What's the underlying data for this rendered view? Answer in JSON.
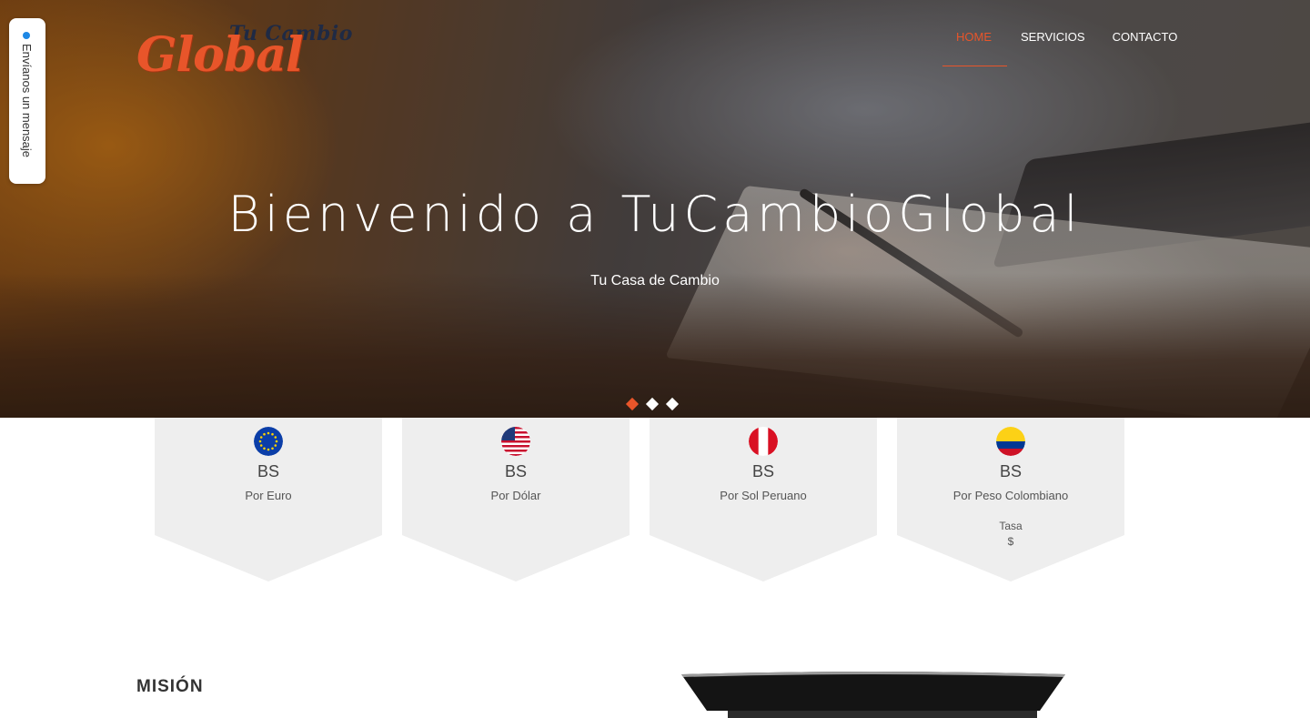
{
  "brand": {
    "logo_top": "Tu Cambio",
    "logo_main": "Global",
    "accent_color": "#e8552a"
  },
  "nav": {
    "items": [
      {
        "label": "HOME",
        "active": true
      },
      {
        "label": "SERVICIOS",
        "active": false
      },
      {
        "label": "CONTACTO",
        "active": false
      }
    ]
  },
  "feedback": {
    "label": "Envíanos un mensaje",
    "icon": "blue-dot-icon"
  },
  "hero": {
    "title": "Bienvenido a TuCambioGlobal",
    "subtitle": "Tu Casa de Cambio",
    "slides": 3,
    "active_slide": 1
  },
  "rates": [
    {
      "flag": "eu-flag-icon",
      "currency": "BS",
      "label": "Por Euro"
    },
    {
      "flag": "us-flag-icon",
      "currency": "BS",
      "label": "Por Dólar"
    },
    {
      "flag": "peru-flag-icon",
      "currency": "BS",
      "label": "Por Sol Peruano"
    },
    {
      "flag": "colombia-flag-icon",
      "currency": "BS",
      "label": "Por Peso Colombiano",
      "tasa_label": "Tasa",
      "tasa_value": "$"
    }
  ],
  "mision": {
    "heading": "MISIÓN"
  }
}
